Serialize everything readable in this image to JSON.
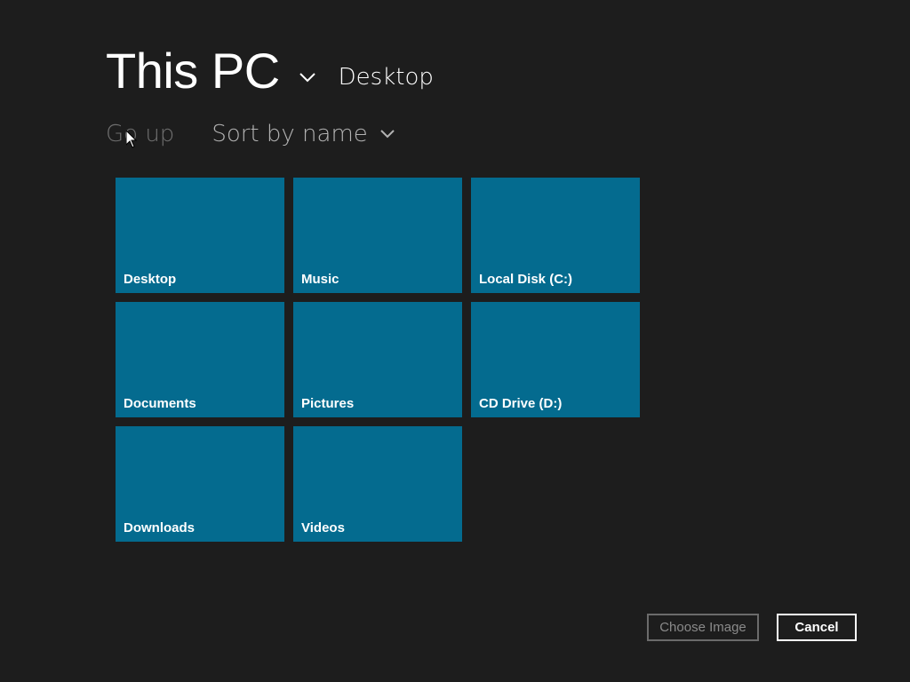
{
  "header": {
    "title": "This PC",
    "title_icon": "chevron-down-icon",
    "subfolder": "Desktop"
  },
  "commands": {
    "go_up": "Go up",
    "sort": "Sort by name",
    "sort_icon": "chevron-down-icon"
  },
  "tiles": [
    {
      "label": "Desktop"
    },
    {
      "label": "Documents"
    },
    {
      "label": "Downloads"
    },
    {
      "label": "Music"
    },
    {
      "label": "Pictures"
    },
    {
      "label": "Videos"
    },
    {
      "label": "Local Disk (C:)"
    },
    {
      "label": "CD Drive (D:)"
    }
  ],
  "footer": {
    "choose_label": "Choose Image",
    "cancel_label": "Cancel"
  },
  "colors": {
    "background": "#1d1d1d",
    "tile": "#046b8f",
    "disabled_text": "#6f6f6f"
  }
}
